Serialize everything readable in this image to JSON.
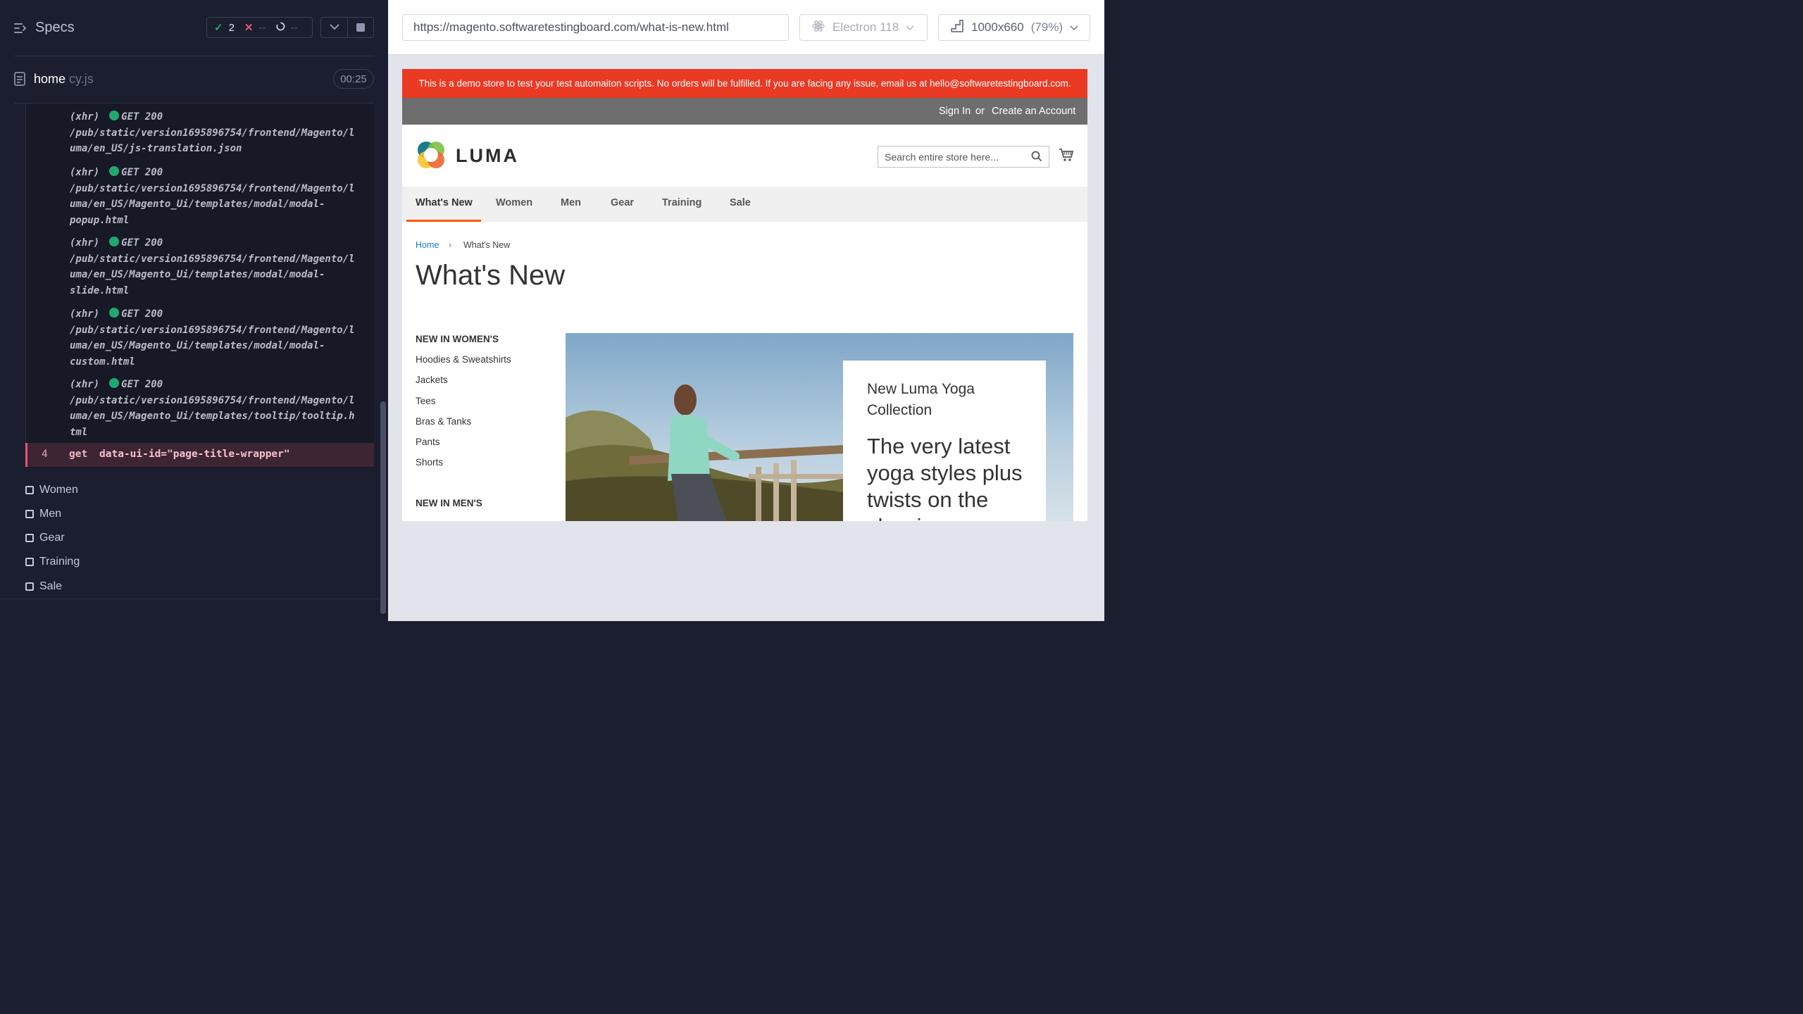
{
  "runner": {
    "specs_label": "Specs",
    "stats": {
      "passed": "2",
      "failed": "--",
      "pending": "--"
    },
    "spec_file": {
      "name": "home",
      "ext": "cy.js",
      "duration": "00:25"
    },
    "log_entries": [
      {
        "kind": "(xhr)",
        "status": "GET 200",
        "path_lines": [
          "/pub/static/version1695896754/frontend/Magento/l",
          "uma/en_US/js-translation.json"
        ]
      },
      {
        "kind": "(xhr)",
        "status": "GET 200",
        "path_lines": [
          "/pub/static/version1695896754/frontend/Magento/l",
          "uma/en_US/Magento_Ui/templates/modal/modal-",
          "popup.html"
        ]
      },
      {
        "kind": "(xhr)",
        "status": "GET 200",
        "path_lines": [
          "/pub/static/version1695896754/frontend/Magento/l",
          "uma/en_US/Magento_Ui/templates/modal/modal-",
          "slide.html"
        ]
      },
      {
        "kind": "(xhr)",
        "status": "GET 200",
        "path_lines": [
          "/pub/static/version1695896754/frontend/Magento/l",
          "uma/en_US/Magento_Ui/templates/modal/modal-",
          "custom.html"
        ]
      },
      {
        "kind": "(xhr)",
        "status": "GET 200",
        "path_lines": [
          "/pub/static/version1695896754/frontend/Magento/l",
          "uma/en_US/Magento_Ui/templates/tooltip/tooltip.h",
          "tml"
        ]
      }
    ],
    "failed_command": {
      "number": "4",
      "name": "get",
      "arg": "data-ui-id=\"page-title-wrapper\""
    },
    "tests": [
      "Women",
      "Men",
      "Gear",
      "Training",
      "Sale"
    ]
  },
  "browser": {
    "url": "https://magento.softwaretestingboard.com/what-is-new.html",
    "browser_name": "Electron 118",
    "viewport": "1000x660",
    "scale": "(79%)"
  },
  "store": {
    "demo_notice": "This is a demo store to test your test automaiton scripts. No orders will be fulfilled. If you are facing any issue, email us at hello@softwaretestingboard.com.",
    "sign_in": "Sign In",
    "or": "or",
    "create_account": "Create an Account",
    "logo_text": "LUMA",
    "search_placeholder": "Search entire store here...",
    "nav": [
      "What's New",
      "Women",
      "Men",
      "Gear",
      "Training",
      "Sale"
    ],
    "breadcrumb": {
      "home": "Home",
      "separator": "›",
      "current": "What's New"
    },
    "page_title": "What's New",
    "women_heading": "NEW IN WOMEN'S",
    "women_links": [
      "Hoodies & Sweatshirts",
      "Jackets",
      "Tees",
      "Bras & Tanks",
      "Pants",
      "Shorts"
    ],
    "men_heading": "NEW IN MEN'S",
    "hero_subtitle": "New Luma Yoga Collection",
    "hero_title": "The very latest yoga styles plus twists on the classics"
  },
  "colors": {
    "runner_bg": "#1b1e2e",
    "pass": "#1fa971",
    "fail": "#e45770",
    "demo_banner": "#ea3a24",
    "nav_active": "#ff5501",
    "link": "#1979c3"
  }
}
